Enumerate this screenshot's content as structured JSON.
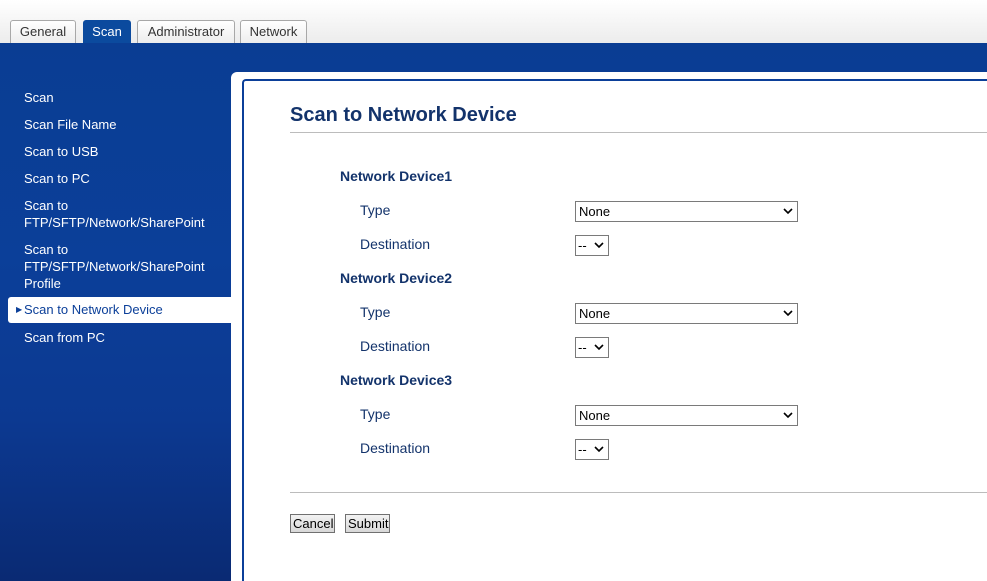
{
  "tabs": [
    {
      "label": "General",
      "active": false
    },
    {
      "label": "Scan",
      "active": true
    },
    {
      "label": "Administrator",
      "active": false
    },
    {
      "label": "Network",
      "active": false
    }
  ],
  "sidebar": {
    "items": [
      {
        "label": "Scan"
      },
      {
        "label": "Scan File Name"
      },
      {
        "label": "Scan to USB"
      },
      {
        "label": "Scan to PC"
      },
      {
        "label": "Scan to FTP/SFTP/Network/SharePoint"
      },
      {
        "label": "Scan to FTP/SFTP/Network/SharePoint Profile"
      },
      {
        "label": "Scan to Network Device",
        "active": true
      },
      {
        "label": "Scan from PC"
      }
    ]
  },
  "main": {
    "title": "Scan to Network Device",
    "devices": [
      {
        "heading": "Network Device1",
        "type_label": "Type",
        "type_value": "None",
        "destination_label": "Destination",
        "destination_value": "--"
      },
      {
        "heading": "Network Device2",
        "type_label": "Type",
        "type_value": "None",
        "destination_label": "Destination",
        "destination_value": "--"
      },
      {
        "heading": "Network Device3",
        "type_label": "Type",
        "type_value": "None",
        "destination_label": "Destination",
        "destination_value": "--"
      }
    ],
    "buttons": {
      "cancel": "Cancel",
      "submit": "Submit"
    }
  },
  "colors": {
    "accent_blue": "#0b3f99",
    "heading_navy": "#13336b"
  },
  "icons": {
    "dropdown": "chevron-down-icon",
    "active_marker": "caret-right-icon"
  }
}
